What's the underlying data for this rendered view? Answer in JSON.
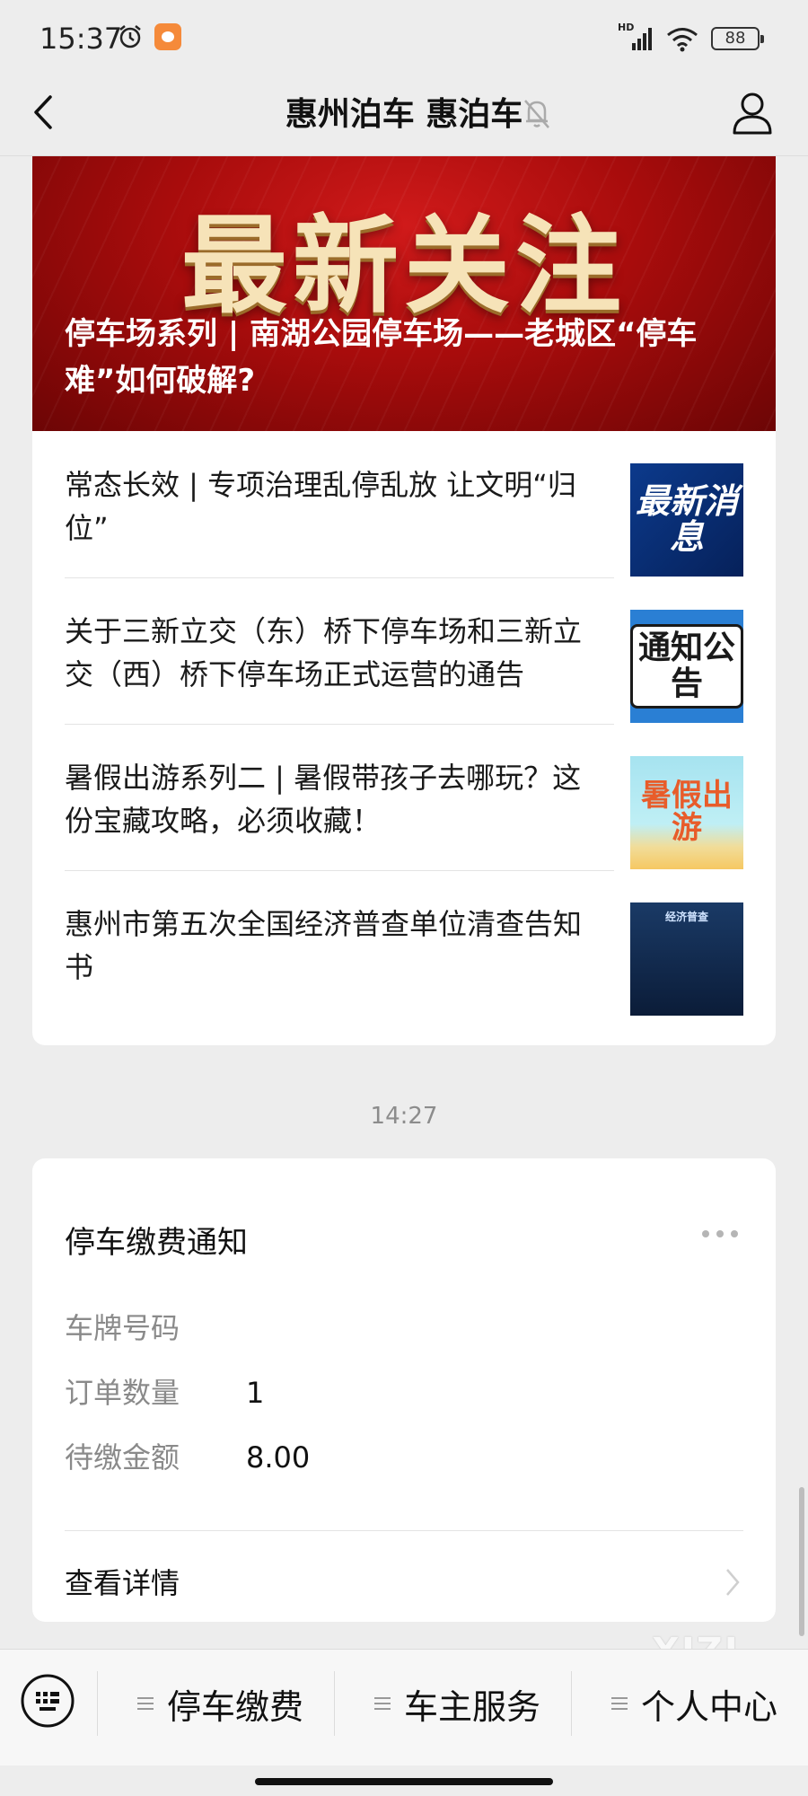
{
  "status_bar": {
    "time": "15:37",
    "battery": "88",
    "network": "HD",
    "icons": [
      "alarm-icon",
      "app-notification-icon",
      "signal-icon",
      "wifi-icon",
      "battery-icon"
    ]
  },
  "nav": {
    "title": "惠州泊车 惠泊车",
    "icons": [
      "back-icon",
      "mute-bell-icon",
      "profile-icon"
    ]
  },
  "banner": {
    "heading": "最新关注",
    "caption": "停车场系列 | 南湖公园停车场——老城区“停车难”如何破解?"
  },
  "news": [
    {
      "title": "常态长效 | 专项治理乱停乱放 让文明“归位”",
      "thumb_text": "最新消息"
    },
    {
      "title": "关于三新立交（东）桥下停车场和三新立交（西）桥下停车场正式运营的通告",
      "thumb_text": "通知公告"
    },
    {
      "title": "暑假出游系列二 | 暑假带孩子去哪玩？这份宝藏攻略，必须收藏！",
      "thumb_text": "暑假出游"
    },
    {
      "title": "惠州市第五次全国经济普查单位清查告知书",
      "thumb_text": "经济普查"
    }
  ],
  "timestamp": "14:27",
  "payment": {
    "title": "停车缴费通知",
    "rows": [
      {
        "label": "车牌号码",
        "value": ""
      },
      {
        "label": "订单数量",
        "value": "1"
      },
      {
        "label": "待缴金额",
        "value": "8.00"
      }
    ],
    "detail_label": "查看详情"
  },
  "watermark": "XIZI",
  "bottom_menu": {
    "items": [
      {
        "label": "停车缴费"
      },
      {
        "label": "车主服务"
      },
      {
        "label": "个人中心"
      }
    ]
  },
  "colors": {
    "background": "#ededed",
    "banner_red": "#a80c0c",
    "banner_gold": "#f6e3b8",
    "card": "#ffffff",
    "muted_text": "#8a8a8a"
  }
}
